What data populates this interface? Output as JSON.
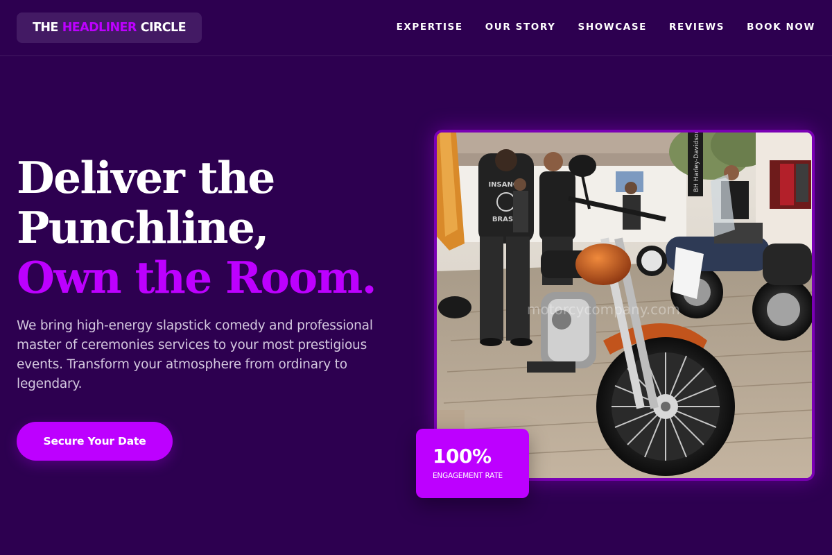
{
  "brand": {
    "part1": "THE",
    "part2": "HEADLINER",
    "part3": "CIRCLE"
  },
  "nav": {
    "items": [
      {
        "label": "EXPERTISE"
      },
      {
        "label": "OUR STORY"
      },
      {
        "label": "SHOWCASE"
      },
      {
        "label": "REVIEWS"
      },
      {
        "label": "BOOK NOW"
      }
    ]
  },
  "hero": {
    "heading_line1": "Deliver the",
    "heading_line2": "Punchline,",
    "heading_highlight": "Own the Room.",
    "description": "We bring high-energy slapstick comedy and professional master of ceremonies services to your most prestigious events. Transform your atmosphere from ordinary to legendary.",
    "cta_label": "Secure Your Date"
  },
  "image": {
    "jacket_text_top": "INSANOS",
    "jacket_text_bottom": "BRASIL",
    "banner_text": "BH Harley-Davidson",
    "watermark": "motorcycompany.com"
  },
  "stat": {
    "value": "100%",
    "label": "ENGAGEMENT RATE"
  },
  "colors": {
    "background": "#2d0050",
    "accent": "#bd00ff",
    "logo_bg": "#431a64",
    "image_border": "#7a00b4"
  }
}
